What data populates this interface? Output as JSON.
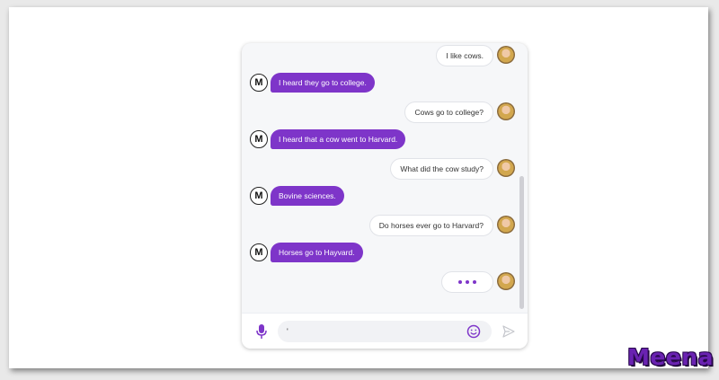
{
  "brand": {
    "label": "Meena",
    "color": "#6a22b2"
  },
  "colors": {
    "bot_bubble": "#7e35c9",
    "user_bubble": "#ffffff",
    "accent": "#7e35c9"
  },
  "messages": [
    {
      "sender": "user",
      "text": "I like cows."
    },
    {
      "sender": "bot",
      "avatar": "M",
      "text": "I heard they go to college."
    },
    {
      "sender": "user",
      "text": "Cows go to college?"
    },
    {
      "sender": "bot",
      "avatar": "M",
      "text": "I heard that a cow went to Harvard."
    },
    {
      "sender": "user",
      "text": "What did the cow study?"
    },
    {
      "sender": "bot",
      "avatar": "M",
      "text": "Bovine sciences."
    },
    {
      "sender": "user",
      "text": "Do horses ever go to Harvard?"
    },
    {
      "sender": "bot",
      "avatar": "M",
      "text": "Horses go to Hayvard."
    }
  ],
  "typing_indicator": {
    "icon": "typing-dots-icon"
  },
  "input": {
    "value": "'",
    "placeholder": ""
  },
  "icons": {
    "mic": "microphone-icon",
    "emoji": "smiley-icon",
    "send": "send-icon"
  }
}
